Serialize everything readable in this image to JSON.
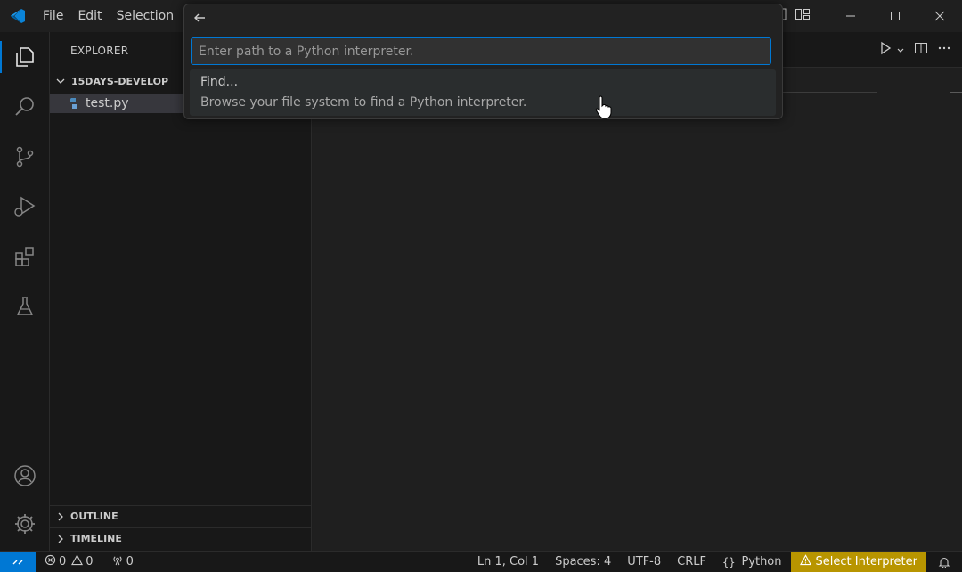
{
  "menu": [
    "File",
    "Edit",
    "Selection"
  ],
  "sidebar": {
    "title": "EXPLORER",
    "folder": "15DAYS-DEVELOP",
    "file": "test.py",
    "sections": [
      "OUTLINE",
      "TIMELINE"
    ]
  },
  "quick_input": {
    "placeholder": "Enter path to a Python interpreter.",
    "items": [
      {
        "label": "Find...",
        "description": "Browse your file system to find a Python interpreter."
      }
    ]
  },
  "status": {
    "errors": "0",
    "warnings": "0",
    "ports": "0",
    "position": "Ln 1, Col 1",
    "spaces": "Spaces: 4",
    "encoding": "UTF-8",
    "eol": "CRLF",
    "language": "Python",
    "interpreter": "Select Interpreter"
  },
  "colors": {
    "accent": "#0078d4",
    "warning_bg": "#b89500"
  }
}
